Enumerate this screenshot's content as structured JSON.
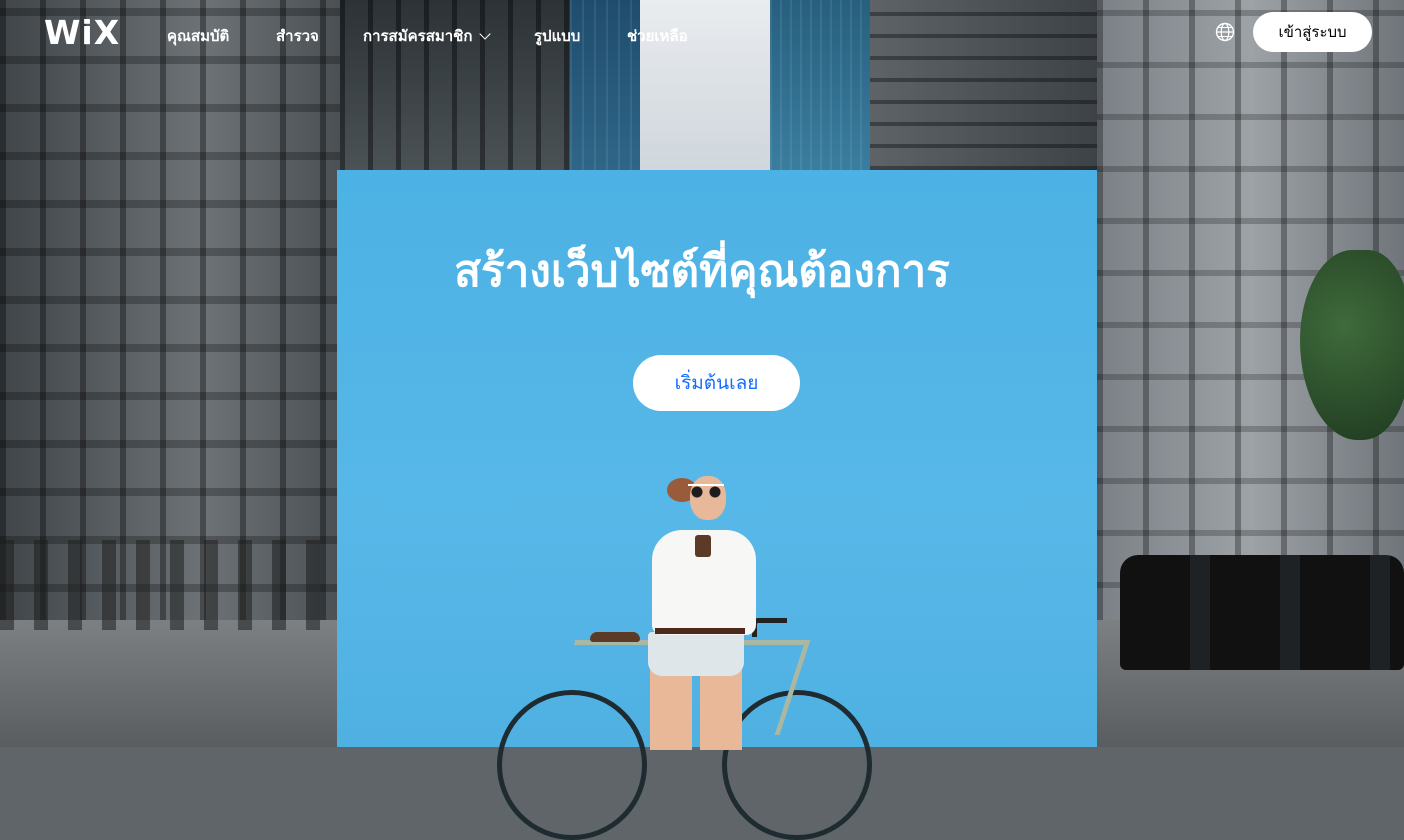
{
  "nav": {
    "logo": "WiX",
    "items": [
      {
        "label": "คุณสมบัติ"
      },
      {
        "label": "สำรวจ"
      },
      {
        "label": "การสมัครสมาชิก",
        "has_dropdown": true
      },
      {
        "label": "รูปแบบ"
      },
      {
        "label": "ช่วยเหลือ"
      }
    ],
    "language_icon": "globe-icon",
    "login_label": "เข้าสู่ระบบ"
  },
  "hero": {
    "title": "สร้างเว็บไซต์ที่คุณต้องการ",
    "cta_label": "เริ่มต้นเลย",
    "panel_color": "#52B5E6",
    "cta_text_color": "#116DFF"
  }
}
